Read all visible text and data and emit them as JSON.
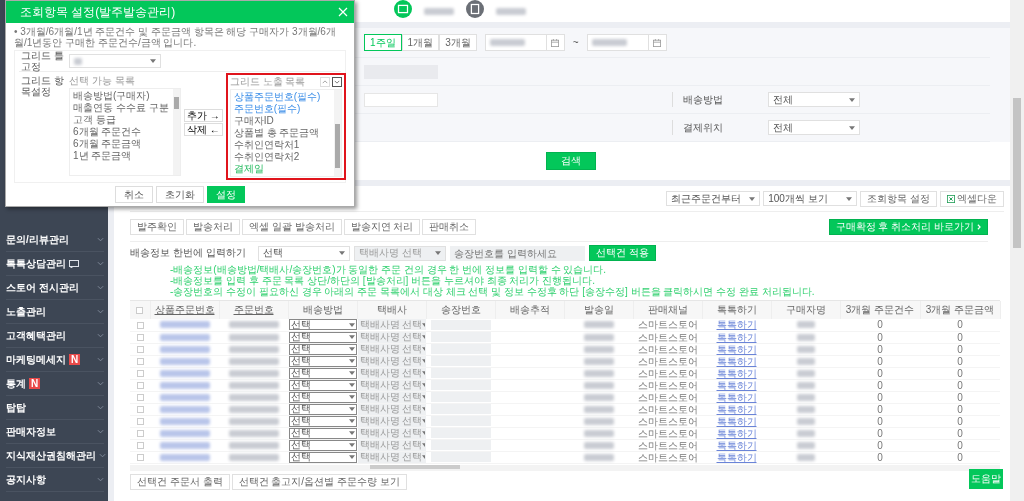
{
  "modal": {
    "title": "조회항목 설정(발주발송관리)",
    "note": "• 3개월/6개월/1년 주문건수 및 주문금액 항목은 해당 구매자가 3개월/6개월/1년동안 구매한 주문건수/금액 입니다.",
    "freeze_label": "그리드 틀고정",
    "items_label": "그리드 항목설정",
    "available": {
      "title": "선택 가능 목록",
      "items": [
        "배송방법(구매자)",
        "매출연동 수수료 구분",
        "고객 등급",
        "6개월 주문건수",
        "6개월 주문금액",
        "1년 주문금액"
      ]
    },
    "add_button": "추가 →",
    "remove_button": "삭제 ←",
    "visible": {
      "title": "그리드 노출 목록",
      "highlighted": true,
      "items": [
        {
          "label": "상품주문번호(필수)",
          "kind": "required"
        },
        {
          "label": "주문번호(필수)",
          "kind": "required"
        },
        {
          "label": "구매자ID",
          "kind": "plain"
        },
        {
          "label": "상품별 총 주문금액",
          "kind": "plain"
        },
        {
          "label": "수취인연락처1",
          "kind": "plain"
        },
        {
          "label": "수취인연락처2",
          "kind": "plain"
        },
        {
          "label": "결제일",
          "kind": "added"
        }
      ]
    },
    "buttons": [
      {
        "label": "취소",
        "primary": false
      },
      {
        "label": "초기화",
        "primary": false
      },
      {
        "label": "설정",
        "primary": true
      }
    ]
  },
  "sidebar": {
    "items": [
      {
        "label": "문의/리뷰관리"
      },
      {
        "label": "톡톡상담관리",
        "kind": "chat"
      },
      {
        "label": "스토어 전시관리"
      },
      {
        "label": "노출관리"
      },
      {
        "label": "고객혜택관리"
      },
      {
        "label": "마케팅메세지",
        "badge": "N"
      },
      {
        "label": "통계",
        "badge": "N"
      },
      {
        "label": "탑탑"
      },
      {
        "label": "판매자정보"
      },
      {
        "label": "지식재산권침해관리"
      },
      {
        "label": "공지사항"
      }
    ]
  },
  "search": {
    "periods": [
      {
        "label": "1주일",
        "selected": true
      },
      {
        "label": "1개월",
        "selected": false
      },
      {
        "label": "3개월",
        "selected": false
      }
    ],
    "date_separator": "~",
    "filters": [
      {
        "label": "배송방법",
        "value": "전체"
      },
      {
        "label": "결제위치",
        "value": "전체"
      }
    ],
    "search_button": "검색"
  },
  "list": {
    "sort": "최근주문건부터",
    "page_size": "100개씩 보기",
    "column_settings": "조회항목 설정",
    "excel": "엑셀다운",
    "actions": [
      "발주확인",
      "발송처리",
      "엑셀 일괄 발송처리",
      "발송지연 처리",
      "판매취소"
    ],
    "cancel_link": "구매확정 후 취소처리 바로가기",
    "batch": {
      "label": "배송정보 한번에 입력하기",
      "method": "선택",
      "courier": "택배사명 선택",
      "tracking_placeholder": "송장번호를 입력하세요",
      "apply": "선택건 적용"
    },
    "notes": [
      "-배송정보(배송방법/택배사/송장번호)가 동일한 주문 건의 경우 한 번에 정보를 입력할 수 있습니다.",
      "-배송정보를 입력 후 주문 목록 상단/하단의 [발송처리] 버튼을 누르셔야 최종 처리가 진행됩니다.",
      "-송장번호의 수정이 필요하신 경우 아래의 주문 목록에서 대상 체크 선택 및 정보 수정후 하단 [송장수정] 버튼을 클릭하시면 수정 완료 처리됩니다."
    ],
    "table": {
      "header_checked": false,
      "columns": [
        {
          "label": "상품주문번호",
          "sortable": true
        },
        {
          "label": "주문번호",
          "sortable": true
        },
        {
          "label": "배송방법",
          "sortable": false
        },
        {
          "label": "택배사",
          "sortable": false
        },
        {
          "label": "송장번호",
          "sortable": false
        },
        {
          "label": "배송추적",
          "sortable": false
        },
        {
          "label": "발송일",
          "sortable": false
        },
        {
          "label": "판매채널",
          "sortable": false
        },
        {
          "label": "톡톡하기",
          "sortable": false
        },
        {
          "label": "구매자명",
          "sortable": false
        },
        {
          "label": "3개월 주문건수",
          "sortable": false
        },
        {
          "label": "3개월 주문금액",
          "sortable": false
        }
      ],
      "rows": [
        {
          "checked": false,
          "method": "선택",
          "courier": "택배사명 선택",
          "courier_disabled": true,
          "channel": "스마트스토어",
          "talk": "톡톡하기",
          "orders_3m": "0",
          "amount_3m": "0"
        },
        {
          "checked": false,
          "method": "선택",
          "courier": "택배사명 선택",
          "courier_disabled": true,
          "channel": "스마트스토어",
          "talk": "톡톡하기",
          "orders_3m": "0",
          "amount_3m": "0"
        },
        {
          "checked": false,
          "method": "선택",
          "courier": "택배사명 선택",
          "courier_disabled": true,
          "channel": "스마트스토어",
          "talk": "톡톡하기",
          "orders_3m": "0",
          "amount_3m": "0"
        },
        {
          "checked": false,
          "method": "선택",
          "courier": "택배사명 선택",
          "courier_disabled": true,
          "channel": "스마트스토어",
          "talk": "톡톡하기",
          "orders_3m": "0",
          "amount_3m": "0"
        },
        {
          "checked": false,
          "method": "선택",
          "courier": "택배사명 선택",
          "courier_disabled": true,
          "channel": "스마트스토어",
          "talk": "톡톡하기",
          "orders_3m": "0",
          "amount_3m": "0"
        },
        {
          "checked": false,
          "method": "선택",
          "courier": "택배사명 선택",
          "courier_disabled": true,
          "channel": "스마트스토어",
          "talk": "톡톡하기",
          "orders_3m": "0",
          "amount_3m": "0"
        },
        {
          "checked": false,
          "method": "선택",
          "courier": "택배사명 선택",
          "courier_disabled": true,
          "channel": "스마트스토어",
          "talk": "톡톡하기",
          "orders_3m": "0",
          "amount_3m": "0"
        },
        {
          "checked": false,
          "method": "선택",
          "courier": "택배사명 선택",
          "courier_disabled": true,
          "channel": "스마트스토어",
          "talk": "톡톡하기",
          "orders_3m": "0",
          "amount_3m": "0"
        },
        {
          "checked": false,
          "method": "선택",
          "courier": "택배사명 선택",
          "courier_disabled": true,
          "channel": "스마트스토어",
          "talk": "톡톡하기",
          "orders_3m": "0",
          "amount_3m": "0"
        },
        {
          "checked": false,
          "method": "선택",
          "courier": "택배사명 선택",
          "courier_disabled": true,
          "channel": "스마트스토어",
          "talk": "톡톡하기",
          "orders_3m": "0",
          "amount_3m": "0"
        },
        {
          "checked": false,
          "method": "선택",
          "courier": "택배사명 선택",
          "courier_disabled": true,
          "channel": "스마트스토어",
          "talk": "톡톡하기",
          "orders_3m": "0",
          "amount_3m": "0"
        },
        {
          "checked": false,
          "method": "선택",
          "courier": "택배사명 선택",
          "courier_disabled": true,
          "channel": "스마트스토어",
          "talk": "톡톡하기",
          "orders_3m": "0",
          "amount_3m": "0"
        }
      ]
    },
    "bottom_buttons": [
      "선택건 주문서 출력",
      "선택건 출고지/옵션별 주문수량 보기"
    ]
  },
  "help_button": "도움말"
}
